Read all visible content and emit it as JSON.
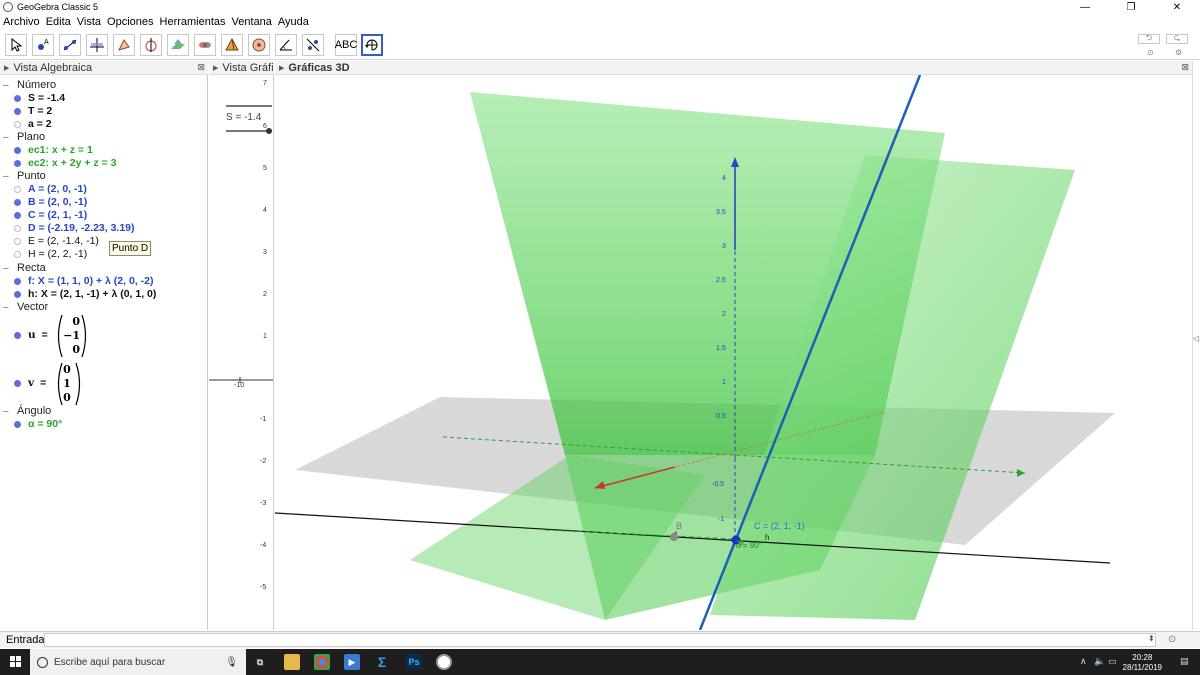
{
  "window": {
    "title": "GeoGebra Classic 5"
  },
  "menu": [
    "Archivo",
    "Edita",
    "Vista",
    "Opciones",
    "Herramientas",
    "Ventana",
    "Ayuda"
  ],
  "toolbar": {
    "text_tool_label": "ABC"
  },
  "panels": {
    "algebra_title": "Vista Algebraica",
    "graphics2d_title": "Vista Gráfic",
    "graphics3d_title": "Gráficas 3D"
  },
  "algebra": {
    "numero": {
      "label": "Número",
      "items": [
        "S = -1.4",
        "T = 2",
        "a = 2"
      ]
    },
    "plano": {
      "label": "Plano",
      "items": [
        "ec1: x + z = 1",
        "ec2: x + 2y + z = 3"
      ]
    },
    "punto": {
      "label": "Punto",
      "items": [
        "A = (2, 0, -1)",
        "B = (2, 0, -1)",
        "C = (2, 1, -1)",
        "D = (-2.19, -2.23, 3.19)",
        "E = (2, -1.4, -1)",
        "H = (2, 2, -1)"
      ]
    },
    "recta": {
      "label": "Recta",
      "items": [
        "f: X = (1, 1, 0) + λ (2, 0, -2)",
        "h: X = (2, 1, -1) + λ (0, 1, 0)"
      ]
    },
    "vector": {
      "label": "Vector",
      "u_label": "u",
      "v_label": "v",
      "equals": "=",
      "u": [
        "0",
        "−1",
        "0"
      ],
      "v": [
        "0",
        "1",
        "0"
      ]
    },
    "angulo": {
      "label": "Ángulo",
      "items": [
        "α = 90°"
      ]
    },
    "tooltip": "Punto D"
  },
  "graphics2d": {
    "slider_label": "S = -1.4",
    "y_ticks": [
      "7",
      "6",
      "5",
      "4",
      "3",
      "2",
      "1",
      "-1",
      "-2",
      "-3",
      "-4",
      "-5"
    ],
    "x_tick": "-10"
  },
  "graphics3d": {
    "z_ticks": [
      "4",
      "3.5",
      "3",
      "2.5",
      "2",
      "1.5",
      "1",
      "0.5",
      "-0.5",
      "-1"
    ],
    "point_b": "B",
    "point_c": "C = (2, 1, -1)",
    "line_h": "h",
    "angle": "α = 90°"
  },
  "input_bar": {
    "label": "Entrada:"
  },
  "taskbar": {
    "search_placeholder": "Escribe aquí para buscar",
    "time": "20:28",
    "date": "28/11/2019"
  }
}
